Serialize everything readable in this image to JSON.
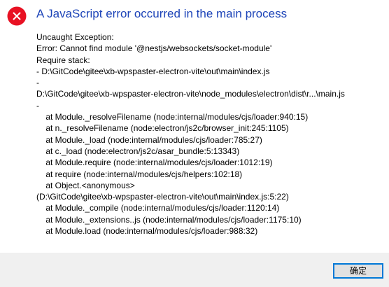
{
  "dialog": {
    "icon": "error-icon",
    "title": "A JavaScript error occurred in the main process",
    "lines": [
      "Uncaught Exception:",
      "Error: Cannot find module '@nestjs/websockets/socket-module'",
      "Require stack:",
      "- D:\\GitCode\\gitee\\xb-wpspaster-electron-vite\\out\\main\\index.js",
      "-",
      "D:\\GitCode\\gitee\\xb-wpspaster-electron-vite\\node_modules\\electron\\dist\\r...\\main.js",
      "-",
      "    at Module._resolveFilename (node:internal/modules/cjs/loader:940:15)",
      "    at n._resolveFilename (node:electron/js2c/browser_init:245:1105)",
      "    at Module._load (node:internal/modules/cjs/loader:785:27)",
      "    at c._load (node:electron/js2c/asar_bundle:5:13343)",
      "    at Module.require (node:internal/modules/cjs/loader:1012:19)",
      "    at require (node:internal/modules/cjs/helpers:102:18)",
      "    at Object.<anonymous>",
      "(D:\\GitCode\\gitee\\xb-wpspaster-electron-vite\\out\\main\\index.js:5:22)",
      "    at Module._compile (node:internal/modules/cjs/loader:1120:14)",
      "    at Module._extensions..js (node:internal/modules/cjs/loader:1175:10)",
      "    at Module.load (node:internal/modules/cjs/loader:988:32)"
    ],
    "ok_label": "确定"
  },
  "colors": {
    "title": "#1d44b8",
    "icon": "#e81123",
    "button_border": "#0078d7",
    "footer": "#f0f0f0"
  }
}
